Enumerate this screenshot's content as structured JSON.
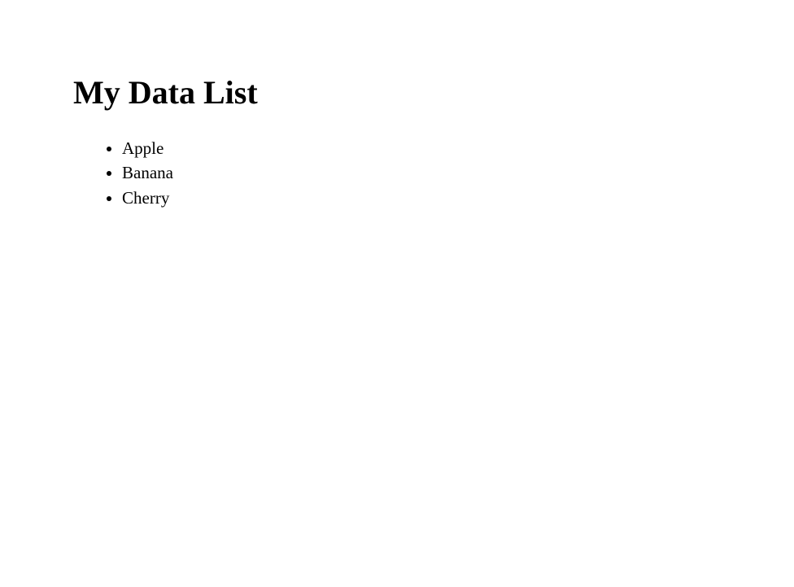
{
  "title": "My Data List",
  "items": [
    "Apple",
    "Banana",
    "Cherry"
  ]
}
